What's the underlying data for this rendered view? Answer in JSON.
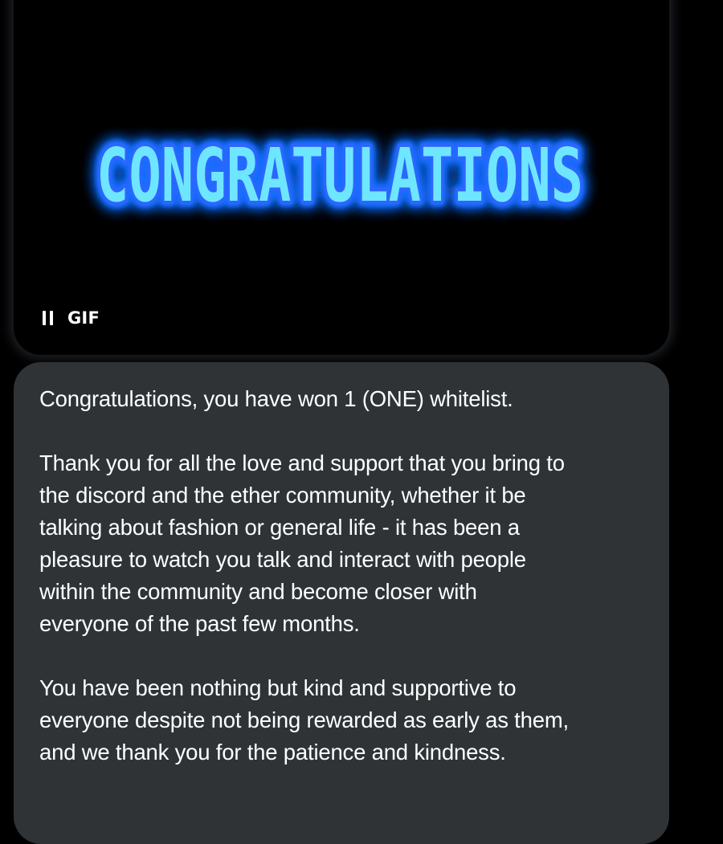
{
  "gif": {
    "text": "CONGRATULATIONS",
    "badge": "GIF",
    "pause_icon": "pause-icon",
    "glow_color": "#1a6dff",
    "text_color": "#6fe6ff"
  },
  "message": {
    "paragraphs": [
      [
        "Congratulations, you have won 1 (ONE) whitelist."
      ],
      [
        "Thank you for all the love and support that you bring to",
        "the discord and the ether community, whether it be",
        "talking about fashion or general life - it has been a",
        "pleasure to watch you talk and interact with people",
        "within the community and become closer with",
        "everyone of the past few months."
      ],
      [
        "You have been nothing but kind and supportive to",
        "everyone despite not being rewarded as early as them,",
        "and we thank you for the patience and kindness."
      ]
    ],
    "bubble_color": "#2f3336"
  }
}
